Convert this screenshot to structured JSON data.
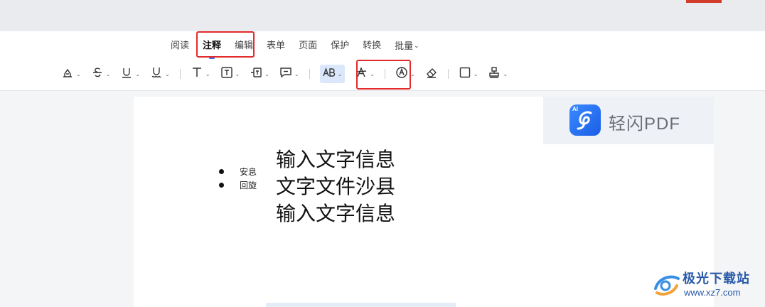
{
  "tabs": [
    {
      "label": "阅读"
    },
    {
      "label": "注释",
      "active": true
    },
    {
      "label": "编辑"
    },
    {
      "label": "表单"
    },
    {
      "label": "页面"
    },
    {
      "label": "保护"
    },
    {
      "label": "转换"
    },
    {
      "label": "批量"
    }
  ],
  "toolbar_icons": [
    "highlight-icon",
    "strikethrough-icon",
    "underline-icon",
    "wavy-underline-icon",
    "text-icon",
    "textbox-icon",
    "callout-icon",
    "note-icon",
    "replace-text-icon",
    "insert-text-icon",
    "pen-icon",
    "eraser-icon",
    "shape-icon",
    "stamp-icon"
  ],
  "document": {
    "bullets": [
      "安息",
      "回旋"
    ],
    "lines": [
      "输入文字信息",
      "文字文件沙县",
      "输入文字信息"
    ]
  },
  "logo": {
    "badge": "AI",
    "name": "轻闪PDF"
  },
  "watermark": {
    "title": "极光下载站",
    "url": "www.xz7.com"
  },
  "colors": {
    "accent": "#3a6ff7",
    "annotation_box": "#e32b2b",
    "logo_blue": "#1a5de6"
  }
}
